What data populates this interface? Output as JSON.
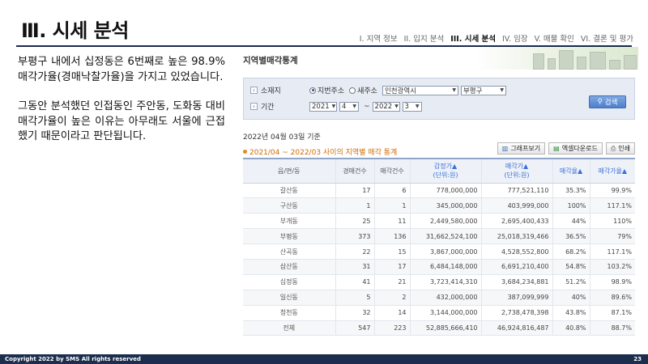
{
  "slide": {
    "title": "Ⅲ. 시세 분석",
    "nav": [
      {
        "label": "I. 지역 정보",
        "active": false
      },
      {
        "label": "II. 입지 분석",
        "active": false
      },
      {
        "label": "III. 시세 분석",
        "active": true
      },
      {
        "label": "IV. 임장",
        "active": false
      },
      {
        "label": "V. 매물 확인",
        "active": false
      },
      {
        "label": "VI. 결론 및 평가",
        "active": false
      }
    ],
    "paragraphs": [
      "부평구 내에서 십정동은 6번째로 높은 98.9% 매각가율(경매낙찰가율)을 가지고 있었습니다.",
      "그동안 분석했던 인접동인 주안동, 도화동 대비 매각가율이 높은 이유는 아무래도 서울에 근접했기 때문이라고 판단됩니다."
    ],
    "footer_left": "Copyright 2022 by SMS All rights reserved",
    "page_number": "23"
  },
  "screen": {
    "title": "지역별매각통계",
    "search": {
      "location_label": "소재지",
      "radio_jibun": "지번주소",
      "radio_new": "새주소",
      "city": "인천광역시",
      "district": "부평구",
      "period_label": "기간",
      "start_year": "2021",
      "start_month": "4",
      "separator": "~",
      "end_year": "2022",
      "end_month": "3",
      "search_button": "검색"
    },
    "date_basis": "2022년 04월 03일 기준",
    "subtitle": "2021/04 ~ 2022/03 사이의 지역별 매각 통계",
    "buttons": {
      "graph": "그래프보기",
      "excel": "엑셀다운로드",
      "print": "인쇄"
    },
    "columns": [
      {
        "label": "읍/면/동",
        "blue": false
      },
      {
        "label": "경매건수",
        "blue": false
      },
      {
        "label": "매각건수",
        "blue": false
      },
      {
        "label": "감정가▲\n(단위:원)",
        "blue": true
      },
      {
        "label": "매각가▲\n(단위:원)",
        "blue": true
      },
      {
        "label": "매각율▲",
        "blue": true
      },
      {
        "label": "매각가율▲",
        "blue": true
      }
    ],
    "rows": [
      [
        "갈산동",
        "17",
        "6",
        "778,000,000",
        "777,521,110",
        "35.3%",
        "99.9%"
      ],
      [
        "구산동",
        "1",
        "1",
        "345,000,000",
        "403,999,000",
        "100%",
        "117.1%"
      ],
      [
        "부개동",
        "25",
        "11",
        "2,449,580,000",
        "2,695,400,433",
        "44%",
        "110%"
      ],
      [
        "부평동",
        "373",
        "136",
        "31,662,524,100",
        "25,018,319,466",
        "36.5%",
        "79%"
      ],
      [
        "산곡동",
        "22",
        "15",
        "3,867,000,000",
        "4,528,552,800",
        "68.2%",
        "117.1%"
      ],
      [
        "삼산동",
        "31",
        "17",
        "6,484,148,000",
        "6,691,210,400",
        "54.8%",
        "103.2%"
      ],
      [
        "십정동",
        "41",
        "21",
        "3,723,414,310",
        "3,684,234,881",
        "51.2%",
        "98.9%"
      ],
      [
        "일신동",
        "5",
        "2",
        "432,000,000",
        "387,099,999",
        "40%",
        "89.6%"
      ],
      [
        "청천동",
        "32",
        "14",
        "3,144,000,000",
        "2,738,478,398",
        "43.8%",
        "87.1%"
      ],
      [
        "전체",
        "547",
        "223",
        "52,885,666,410",
        "46,924,816,487",
        "40.8%",
        "88.7%"
      ]
    ]
  }
}
